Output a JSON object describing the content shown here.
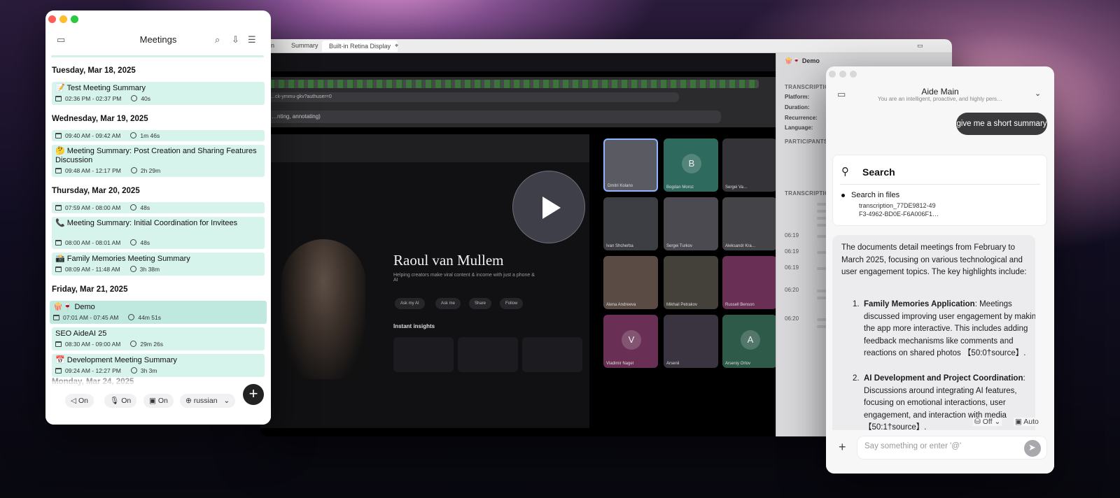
{
  "meetings": {
    "title": "Meetings",
    "groups": [
      {
        "date": "Tuesday, Mar 18, 2025",
        "items": [
          {
            "title": "📝 Test Meeting Summary",
            "time": "02:36 PM - 02:37 PM",
            "duration": "40s"
          }
        ]
      },
      {
        "date": "Wednesday, Mar 19, 2025",
        "items": [
          {
            "title": "",
            "time": "09:40 AM - 09:42 AM",
            "duration": "1m 46s"
          },
          {
            "title": "🤔 Meeting Summary: Post Creation and Sharing Features Discussion",
            "time": "09:48 AM - 12:17 PM",
            "duration": "2h 29m"
          }
        ]
      },
      {
        "date": "Thursday, Mar 20, 2025",
        "items": [
          {
            "title": "",
            "time": "07:59 AM - 08:00 AM",
            "duration": "48s"
          },
          {
            "title": "📞 Meeting Summary: Initial Coordination for Invitees",
            "time": "08:00 AM - 08:01 AM",
            "duration": "48s"
          },
          {
            "title": "📸 Family Memories Meeting Summary",
            "time": "08:09 AM - 11:48 AM",
            "duration": "3h 38m"
          }
        ]
      },
      {
        "date": "Friday, Mar 21, 2025",
        "items": [
          {
            "title": "🍿🍷 Demo",
            "time": "07:01 AM - 07:45 AM",
            "duration": "44m 51s"
          },
          {
            "title": "SEO AideAI 25",
            "time": "08:30 AM - 09:00 AM",
            "duration": "29m 26s"
          },
          {
            "title": "📅 Development Meeting Summary",
            "time": "09:24 AM - 12:27 PM",
            "duration": "3h 3m"
          }
        ]
      }
    ],
    "next_date": "Monday, Mar 24, 2025",
    "controls": {
      "speaker": "On",
      "mic": "On",
      "screen": "On",
      "language": "russian"
    }
  },
  "player": {
    "tabs": [
      "on",
      "Summary",
      "Built-in Retina Display"
    ],
    "url": "…ck-ymmu-gkv?authuser=0",
    "search_text": "…nting, annotating)",
    "host_name": "Raoul van Mullem",
    "host_sub": "Helping creators make viral content & income with just a phone & AI",
    "insights_label": "Instant insights",
    "pills": [
      "Ask my AI",
      "Ask me",
      "Share",
      "Follow"
    ],
    "participants": [
      {
        "name": "Dmitri Kolano",
        "initial": "",
        "color": "#5a5a62"
      },
      {
        "name": "Bogdan Moroz",
        "initial": "B",
        "color": "#2e6b5e"
      },
      {
        "name": "Sergei Va…",
        "initial": "",
        "color": "#333338"
      },
      {
        "name": "Ivan Shcherba",
        "initial": "",
        "color": "#3d3d44"
      },
      {
        "name": "Sergei Turkov",
        "initial": "",
        "color": "#4a4a50"
      },
      {
        "name": "Aleksandr Kra…",
        "initial": "",
        "color": "#444448"
      },
      {
        "name": "Alena Andreeva",
        "initial": "",
        "color": "#5b4b45"
      },
      {
        "name": "Mikhail Petrakov",
        "initial": "",
        "color": "#44403a"
      },
      {
        "name": "Russell Benson",
        "initial": "",
        "color": "#6a2f55"
      },
      {
        "name": "Vladimir Nagel",
        "initial": "V",
        "color": "#6a2f55"
      },
      {
        "name": "Arsenii",
        "initial": "",
        "color": "#3a3440"
      },
      {
        "name": "Arseniy Orlov",
        "initial": "A",
        "color": "#2e5a4a"
      }
    ],
    "panel": {
      "title": "🍿🍷 Demo",
      "details_label": "TRANSCRIPTION DETAI…",
      "rows": [
        "Platform:",
        "Duration:",
        "Recurrence:",
        "Language:"
      ],
      "participants_label": "PARTICIPANTS",
      "transcription_label": "TRANSCRIPTION",
      "times": [
        "06:19",
        "06:19",
        "06:19",
        "06:20",
        "06:20"
      ]
    }
  },
  "aide": {
    "title": "Aide Main",
    "subtitle": "You are an intelligent, proactive, and highly pers…",
    "user_message": "give me a short summary",
    "tool": {
      "title": "Search",
      "bullet": "Search in files",
      "file_line1": "transcription_77DE9812-49",
      "file_line2": "F3-4962-BD0E-F6A006F1…"
    },
    "answer_intro": "The documents detail meetings from February to March 2025, focusing on various technological and user engagement topics. The key highlights include:",
    "answer_items": [
      {
        "num": "1.",
        "bold": "Family Memories Application",
        "text": ": Meetings discussed improving user engagement by making the app more interactive. This includes adding feedback mechanisms like comments and reactions on shared photos 【50:0†source】."
      },
      {
        "num": "2.",
        "bold": "AI Development and Project Coordination",
        "text": ": Discussions around integrating AI features, focusing on emotional interactions, user engagement, and interaction with media 【50:1†source】."
      }
    ],
    "option_off": "Off",
    "option_auto": "Auto",
    "input_placeholder": "Say something or enter '@'"
  },
  "colors": {
    "meeting_item": "#d6f3ec",
    "meeting_selected": "#bfe8de",
    "traffic_red": "#ff5f57",
    "traffic_yellow": "#febc2e",
    "traffic_green": "#28c840"
  }
}
